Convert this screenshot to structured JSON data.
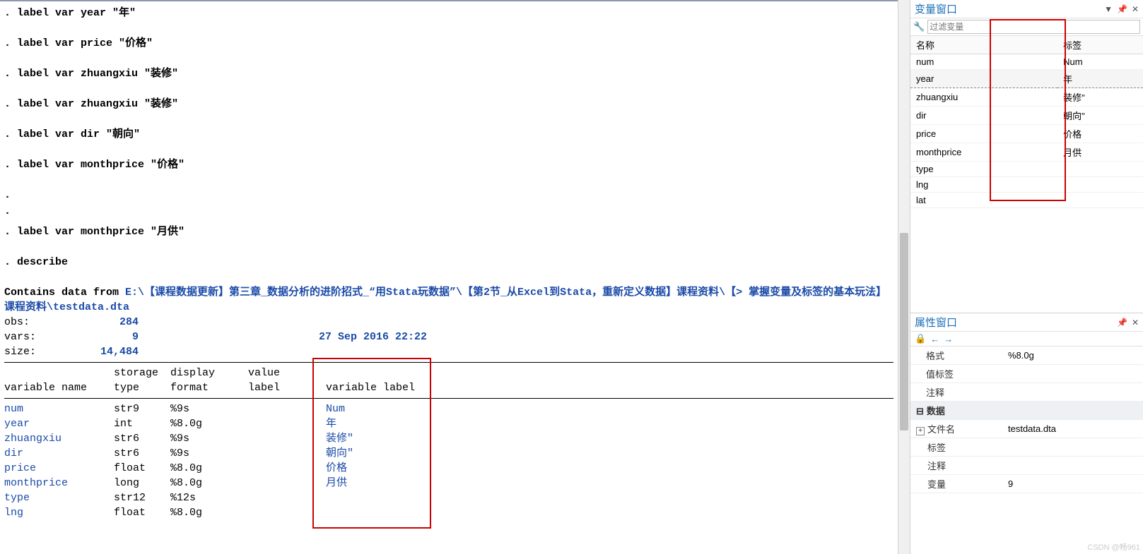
{
  "commands": [
    ". label var year \"年\"",
    ". label var price \"价格\"",
    ". label var zhuangxiu \"装修\"",
    ". label var zhuangxiu \"装修\"",
    ". label var dir \"朝向\"",
    ". label var monthprice \"价格\"",
    ".",
    ".",
    ". label var monthprice \"月供\"",
    ". describe"
  ],
  "contains_prefix": "Contains data from ",
  "datafile_path": "E:\\【课程数据更新】第三章_数据分析的进阶招式_“用Stata玩数据”\\【第2节_从Excel到Stata，重新定义数据】课程资料\\【> 掌握变量及标签的基本玩法】课程资料\\testdata.dta",
  "info": {
    "obs_label": "obs:",
    "obs": "284",
    "vars_label": "vars:",
    "vars": "9",
    "size_label": "size:",
    "size": "14,484",
    "date": "27 Sep 2016 22:22"
  },
  "describe_header": {
    "storage": "storage",
    "display": "display",
    "value": "value",
    "varname": "variable name",
    "type": "type",
    "format": "format",
    "label": "label",
    "vlabel": "variable label"
  },
  "describe_rows": [
    {
      "name": "num",
      "type": "str9",
      "format": "%9s",
      "vlabel": "Num"
    },
    {
      "name": "year",
      "type": "int",
      "format": "%8.0g",
      "vlabel": "年"
    },
    {
      "name": "zhuangxiu",
      "type": "str6",
      "format": "%9s",
      "vlabel": "装修\""
    },
    {
      "name": "dir",
      "type": "str6",
      "format": "%9s",
      "vlabel": "朝向\""
    },
    {
      "name": "price",
      "type": "float",
      "format": "%8.0g",
      "vlabel": "价格"
    },
    {
      "name": "monthprice",
      "type": "long",
      "format": "%8.0g",
      "vlabel": "月供"
    },
    {
      "name": "type",
      "type": "str12",
      "format": "%12s",
      "vlabel": ""
    },
    {
      "name": "lng",
      "type": "float",
      "format": "%8.0g",
      "vlabel": ""
    }
  ],
  "var_panel": {
    "title": "变量窗口",
    "filter_placeholder": "过滤变量",
    "col_name": "名称",
    "col_label": "标签",
    "rows": [
      {
        "name": "num",
        "label": "Num"
      },
      {
        "name": "year",
        "label": "年",
        "sel": true
      },
      {
        "name": "zhuangxiu",
        "label": "装修\""
      },
      {
        "name": "dir",
        "label": "朝向\""
      },
      {
        "name": "price",
        "label": "价格"
      },
      {
        "name": "monthprice",
        "label": "月供"
      },
      {
        "name": "type",
        "label": ""
      },
      {
        "name": "lng",
        "label": ""
      },
      {
        "name": "lat",
        "label": ""
      }
    ]
  },
  "prop_panel": {
    "title": "属性窗口",
    "rows": [
      {
        "k": "格式",
        "v": "%8.0g"
      },
      {
        "k": "值标签",
        "v": ""
      },
      {
        "k": "注释",
        "v": ""
      }
    ],
    "group_label": "数据",
    "rows2": [
      {
        "k": "文件名",
        "v": "testdata.dta",
        "plus": true
      },
      {
        "k": "标签",
        "v": ""
      },
      {
        "k": "注释",
        "v": ""
      },
      {
        "k": "变量",
        "v": "9"
      }
    ]
  },
  "watermark": "CSDN @畅961"
}
